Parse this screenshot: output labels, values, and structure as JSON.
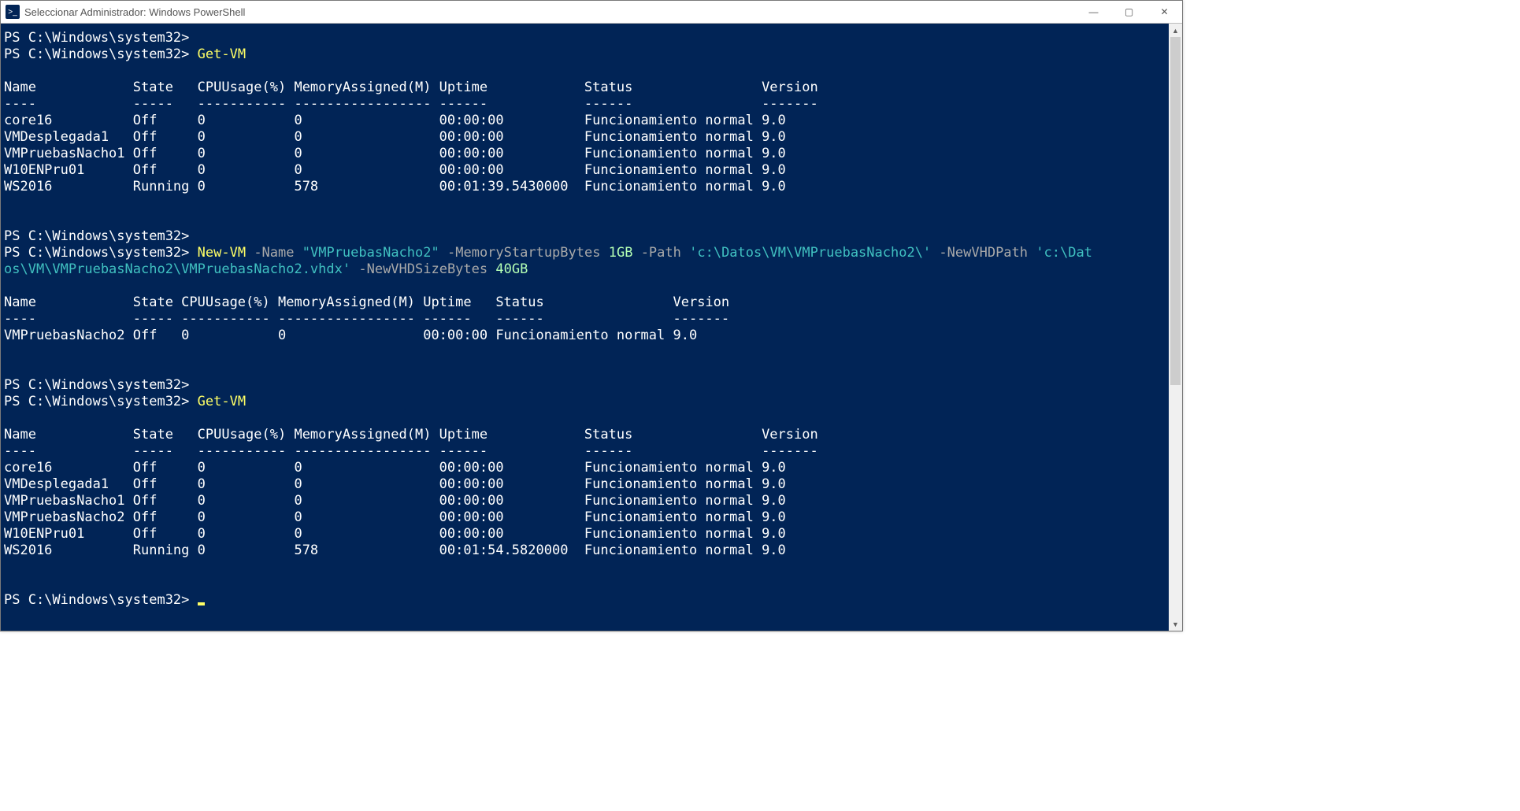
{
  "window": {
    "icon_glyph": ">_",
    "title": "Seleccionar Administrador: Windows PowerShell",
    "controls": {
      "minimize": "—",
      "maximize": "▢",
      "close": "✕"
    }
  },
  "prompt": "PS C:\\Windows\\system32>",
  "cmd1": "Get-VM",
  "cmd3": "Get-VM",
  "cmd2": {
    "cmdlet": "New-VM",
    "p_name_flag": "-Name",
    "p_name_val": "\"VMPruebasNacho2\"",
    "p_mem_flag": "-MemoryStartupBytes",
    "p_mem_val": "1GB",
    "p_path_flag": "-Path",
    "p_path_val": "'c:\\Datos\\VM\\VMPruebasNacho2\\'",
    "p_newvhd_flag": "-NewVHDPath",
    "p_newvhd_val_a": "'c:\\Dat",
    "p_newvhd_val_b": "os\\VM\\VMPruebasNacho2\\VMPruebasNacho2.vhdx'",
    "p_newvhdsize_flag": "-NewVHDSizeBytes",
    "p_newvhdsize_val": "40GB"
  },
  "tableA": {
    "headers": [
      "Name",
      "State",
      "CPUUsage(%)",
      "MemoryAssigned(M)",
      "Uptime",
      "Status",
      "Version"
    ],
    "dashes": [
      "----",
      "-----",
      "-----------",
      "-----------------",
      "------",
      "------",
      "-------"
    ],
    "rows": [
      {
        "name": "core16",
        "state": "Off",
        "cpu": "0",
        "mem": "0",
        "uptime": "00:00:00",
        "status": "Funcionamiento normal",
        "ver": "9.0"
      },
      {
        "name": "VMDesplegada1",
        "state": "Off",
        "cpu": "0",
        "mem": "0",
        "uptime": "00:00:00",
        "status": "Funcionamiento normal",
        "ver": "9.0"
      },
      {
        "name": "VMPruebasNacho1",
        "state": "Off",
        "cpu": "0",
        "mem": "0",
        "uptime": "00:00:00",
        "status": "Funcionamiento normal",
        "ver": "9.0"
      },
      {
        "name": "W10ENPru01",
        "state": "Off",
        "cpu": "0",
        "mem": "0",
        "uptime": "00:00:00",
        "status": "Funcionamiento normal",
        "ver": "9.0"
      },
      {
        "name": "WS2016",
        "state": "Running",
        "cpu": "0",
        "mem": "578",
        "uptime": "00:01:39.5430000",
        "status": "Funcionamiento normal",
        "ver": "9.0"
      }
    ]
  },
  "tableB": {
    "headers": [
      "Name",
      "State",
      "CPUUsage(%)",
      "MemoryAssigned(M)",
      "Uptime",
      "Status",
      "Version"
    ],
    "dashes": [
      "----",
      "-----",
      "-----------",
      "-----------------",
      "------",
      "------",
      "-------"
    ],
    "rows": [
      {
        "name": "VMPruebasNacho2",
        "state": "Off",
        "cpu": "0",
        "mem": "0",
        "uptime": "00:00:00",
        "status": "Funcionamiento normal",
        "ver": "9.0"
      }
    ]
  },
  "tableC": {
    "headers": [
      "Name",
      "State",
      "CPUUsage(%)",
      "MemoryAssigned(M)",
      "Uptime",
      "Status",
      "Version"
    ],
    "dashes": [
      "----",
      "-----",
      "-----------",
      "-----------------",
      "------",
      "------",
      "-------"
    ],
    "rows": [
      {
        "name": "core16",
        "state": "Off",
        "cpu": "0",
        "mem": "0",
        "uptime": "00:00:00",
        "status": "Funcionamiento normal",
        "ver": "9.0"
      },
      {
        "name": "VMDesplegada1",
        "state": "Off",
        "cpu": "0",
        "mem": "0",
        "uptime": "00:00:00",
        "status": "Funcionamiento normal",
        "ver": "9.0"
      },
      {
        "name": "VMPruebasNacho1",
        "state": "Off",
        "cpu": "0",
        "mem": "0",
        "uptime": "00:00:00",
        "status": "Funcionamiento normal",
        "ver": "9.0"
      },
      {
        "name": "VMPruebasNacho2",
        "state": "Off",
        "cpu": "0",
        "mem": "0",
        "uptime": "00:00:00",
        "status": "Funcionamiento normal",
        "ver": "9.0"
      },
      {
        "name": "W10ENPru01",
        "state": "Off",
        "cpu": "0",
        "mem": "0",
        "uptime": "00:00:00",
        "status": "Funcionamiento normal",
        "ver": "9.0"
      },
      {
        "name": "WS2016",
        "state": "Running",
        "cpu": "0",
        "mem": "578",
        "uptime": "00:01:54.5820000",
        "status": "Funcionamiento normal",
        "ver": "9.0"
      }
    ]
  }
}
